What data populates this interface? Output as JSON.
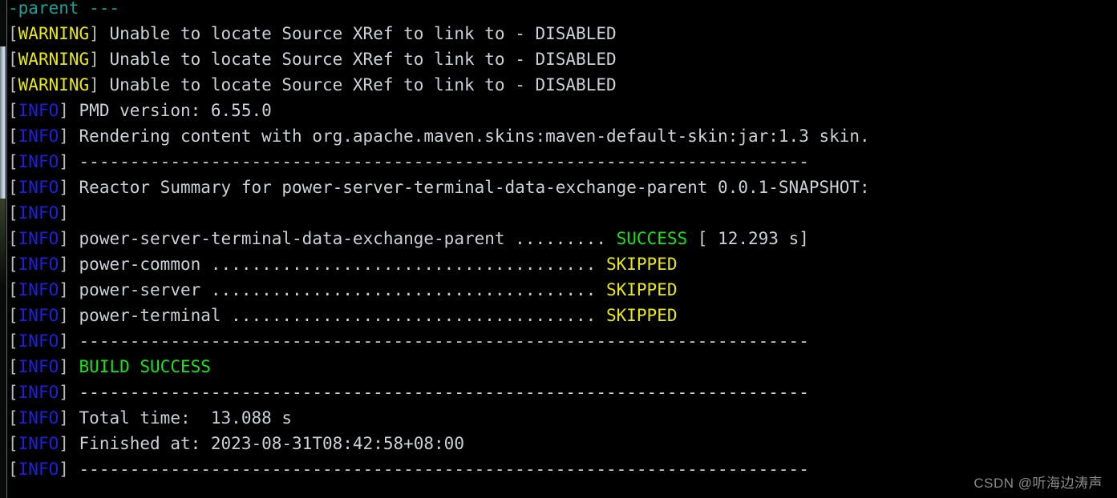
{
  "window": {
    "title": "Maven Build Console Output",
    "background_color": "#000000",
    "default_text_color": "#cdd0d4"
  },
  "colors": {
    "bracket": "#b9bcbf",
    "info": "#1f1fe0",
    "warning": "#e8e800",
    "success": "#15e515",
    "skipped": "#e8e800",
    "cyan": "#12a39a",
    "watermark": "#8b8b8b"
  },
  "scrollbar": {
    "name": "vertical-scrollbar",
    "orientation": "vertical",
    "position": "left"
  },
  "console": {
    "lines": [
      {
        "id": "line-parent-header",
        "segments": [
          {
            "text": "-parent ---",
            "color": "cyan"
          }
        ]
      },
      {
        "id": "line-warning-1",
        "segments": [
          {
            "text": "[",
            "color": "bracket"
          },
          {
            "text": "WARNING",
            "color": "warning"
          },
          {
            "text": "] ",
            "color": "bracket"
          },
          {
            "text": "Unable to locate Source XRef to link to - DISABLED",
            "color": "default"
          }
        ]
      },
      {
        "id": "line-warning-2",
        "segments": [
          {
            "text": "[",
            "color": "bracket"
          },
          {
            "text": "WARNING",
            "color": "warning"
          },
          {
            "text": "] ",
            "color": "bracket"
          },
          {
            "text": "Unable to locate Source XRef to link to - DISABLED",
            "color": "default"
          }
        ]
      },
      {
        "id": "line-warning-3",
        "segments": [
          {
            "text": "[",
            "color": "bracket"
          },
          {
            "text": "WARNING",
            "color": "warning"
          },
          {
            "text": "] ",
            "color": "bracket"
          },
          {
            "text": "Unable to locate Source XRef to link to - DISABLED",
            "color": "default"
          }
        ]
      },
      {
        "id": "line-pmd-version",
        "segments": [
          {
            "text": "[",
            "color": "bracket"
          },
          {
            "text": "INFO",
            "color": "info"
          },
          {
            "text": "] ",
            "color": "bracket"
          },
          {
            "text": "PMD version: 6.55.0",
            "color": "default"
          }
        ]
      },
      {
        "id": "line-rendering-skin",
        "segments": [
          {
            "text": "[",
            "color": "bracket"
          },
          {
            "text": "INFO",
            "color": "info"
          },
          {
            "text": "] ",
            "color": "bracket"
          },
          {
            "text": "Rendering content with org.apache.maven.skins:maven-default-skin:jar:1.3 skin.",
            "color": "default"
          }
        ]
      },
      {
        "id": "line-separator-1",
        "segments": [
          {
            "text": "[",
            "color": "bracket"
          },
          {
            "text": "INFO",
            "color": "info"
          },
          {
            "text": "] ",
            "color": "bracket"
          },
          {
            "text": "------------------------------------------------------------------------",
            "color": "default"
          }
        ]
      },
      {
        "id": "line-reactor-summary",
        "segments": [
          {
            "text": "[",
            "color": "bracket"
          },
          {
            "text": "INFO",
            "color": "info"
          },
          {
            "text": "] ",
            "color": "bracket"
          },
          {
            "text": "Reactor Summary for power-server-terminal-data-exchange-parent 0.0.1-SNAPSHOT:",
            "color": "default"
          }
        ]
      },
      {
        "id": "line-blank-1",
        "segments": [
          {
            "text": "[",
            "color": "bracket"
          },
          {
            "text": "INFO",
            "color": "info"
          },
          {
            "text": "] ",
            "color": "bracket"
          }
        ]
      },
      {
        "id": "line-module-parent",
        "segments": [
          {
            "text": "[",
            "color": "bracket"
          },
          {
            "text": "INFO",
            "color": "info"
          },
          {
            "text": "] ",
            "color": "bracket"
          },
          {
            "text": "power-server-terminal-data-exchange-parent ......... ",
            "color": "default"
          },
          {
            "text": "SUCCESS",
            "color": "success"
          },
          {
            "text": " [ 12.293 s]",
            "color": "default"
          }
        ]
      },
      {
        "id": "line-module-power-common",
        "segments": [
          {
            "text": "[",
            "color": "bracket"
          },
          {
            "text": "INFO",
            "color": "info"
          },
          {
            "text": "] ",
            "color": "bracket"
          },
          {
            "text": "power-common ...................................... ",
            "color": "default"
          },
          {
            "text": "SKIPPED",
            "color": "skipped"
          }
        ]
      },
      {
        "id": "line-module-power-server",
        "segments": [
          {
            "text": "[",
            "color": "bracket"
          },
          {
            "text": "INFO",
            "color": "info"
          },
          {
            "text": "] ",
            "color": "bracket"
          },
          {
            "text": "power-server ...................................... ",
            "color": "default"
          },
          {
            "text": "SKIPPED",
            "color": "skipped"
          }
        ]
      },
      {
        "id": "line-module-power-terminal",
        "segments": [
          {
            "text": "[",
            "color": "bracket"
          },
          {
            "text": "INFO",
            "color": "info"
          },
          {
            "text": "] ",
            "color": "bracket"
          },
          {
            "text": "power-terminal .................................... ",
            "color": "default"
          },
          {
            "text": "SKIPPED",
            "color": "skipped"
          }
        ]
      },
      {
        "id": "line-separator-2",
        "segments": [
          {
            "text": "[",
            "color": "bracket"
          },
          {
            "text": "INFO",
            "color": "info"
          },
          {
            "text": "] ",
            "color": "bracket"
          },
          {
            "text": "------------------------------------------------------------------------",
            "color": "default"
          }
        ]
      },
      {
        "id": "line-build-success",
        "segments": [
          {
            "text": "[",
            "color": "bracket"
          },
          {
            "text": "INFO",
            "color": "info"
          },
          {
            "text": "] ",
            "color": "bracket"
          },
          {
            "text": "BUILD SUCCESS",
            "color": "success"
          }
        ]
      },
      {
        "id": "line-separator-3",
        "segments": [
          {
            "text": "[",
            "color": "bracket"
          },
          {
            "text": "INFO",
            "color": "info"
          },
          {
            "text": "] ",
            "color": "bracket"
          },
          {
            "text": "------------------------------------------------------------------------",
            "color": "default"
          }
        ]
      },
      {
        "id": "line-total-time",
        "segments": [
          {
            "text": "[",
            "color": "bracket"
          },
          {
            "text": "INFO",
            "color": "info"
          },
          {
            "text": "] ",
            "color": "bracket"
          },
          {
            "text": "Total time:  13.088 s",
            "color": "default"
          }
        ]
      },
      {
        "id": "line-finished-at",
        "segments": [
          {
            "text": "[",
            "color": "bracket"
          },
          {
            "text": "INFO",
            "color": "info"
          },
          {
            "text": "] ",
            "color": "bracket"
          },
          {
            "text": "Finished at: 2023-08-31T08:42:58+08:00",
            "color": "default"
          }
        ]
      },
      {
        "id": "line-separator-4",
        "segments": [
          {
            "text": "[",
            "color": "bracket"
          },
          {
            "text": "INFO",
            "color": "info"
          },
          {
            "text": "] ",
            "color": "bracket"
          },
          {
            "text": "------------------------------------------------------------------------",
            "color": "default"
          }
        ]
      }
    ]
  },
  "build_summary": {
    "project": "power-server-terminal-data-exchange-parent",
    "version": "0.0.1-SNAPSHOT",
    "pmd_version": "6.55.0",
    "skin": "org.apache.maven.skins:maven-default-skin:jar:1.3",
    "result": "BUILD SUCCESS",
    "total_time": "13.088 s",
    "finished_at": "2023-08-31T08:42:58+08:00",
    "modules": [
      {
        "name": "power-server-terminal-data-exchange-parent",
        "status": "SUCCESS",
        "duration": "12.293 s"
      },
      {
        "name": "power-common",
        "status": "SKIPPED",
        "duration": ""
      },
      {
        "name": "power-server",
        "status": "SKIPPED",
        "duration": ""
      },
      {
        "name": "power-terminal",
        "status": "SKIPPED",
        "duration": ""
      }
    ],
    "warnings": [
      "Unable to locate Source XRef to link to - DISABLED",
      "Unable to locate Source XRef to link to - DISABLED",
      "Unable to locate Source XRef to link to - DISABLED"
    ]
  },
  "watermark": {
    "text": "CSDN @听海边涛声"
  }
}
